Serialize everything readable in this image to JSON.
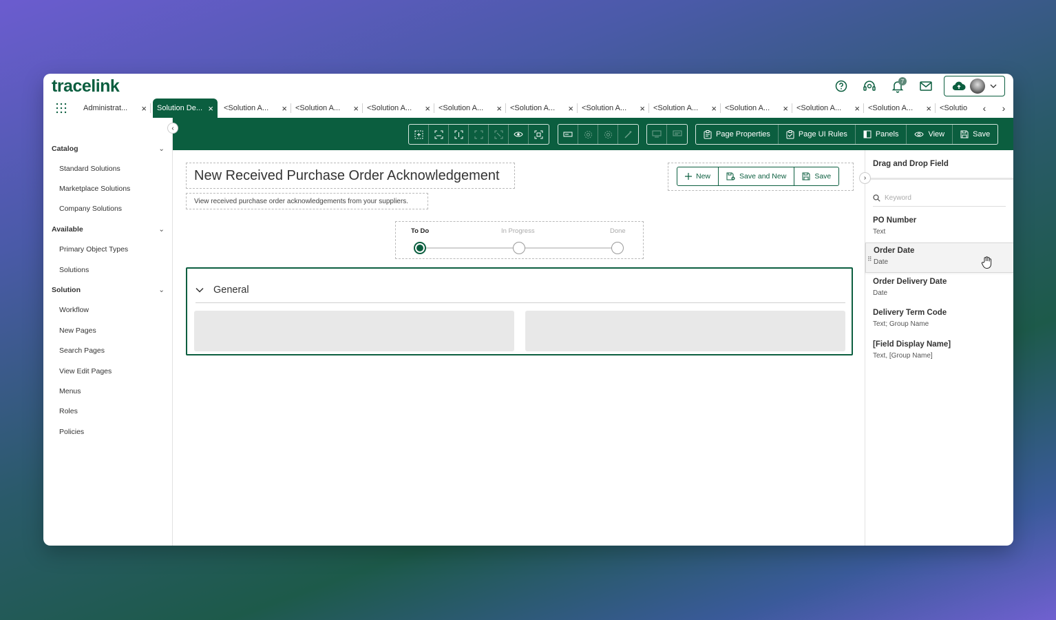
{
  "brand": {
    "logo_text": "tracelink",
    "accent": "#0b5e3f"
  },
  "header": {
    "notification_count": "7",
    "icons": [
      "help-icon",
      "support-icon",
      "bell-icon",
      "mail-icon",
      "cloud-upload-icon"
    ]
  },
  "tabs": {
    "items": [
      {
        "label": "Administrat...",
        "active": false
      },
      {
        "label": "Solution De...",
        "active": true
      },
      {
        "label": "<Solution A...",
        "active": false
      },
      {
        "label": "<Solution A...",
        "active": false
      },
      {
        "label": "<Solution A...",
        "active": false
      },
      {
        "label": "<Solution A...",
        "active": false
      },
      {
        "label": "<Solution A...",
        "active": false
      },
      {
        "label": "<Solution A...",
        "active": false
      },
      {
        "label": "<Solution A...",
        "active": false
      },
      {
        "label": "<Solution A...",
        "active": false
      },
      {
        "label": "<Solution A...",
        "active": false
      },
      {
        "label": "<Solution A...",
        "active": false
      },
      {
        "label": "<Solutio",
        "active": false
      }
    ]
  },
  "sidebar": {
    "sections": [
      {
        "label": "Catalog",
        "items": [
          "Standard Solutions",
          "Marketplace Solutions",
          "Company Solutions"
        ]
      },
      {
        "label": "Available",
        "items": [
          "Primary Object Types",
          "Solutions"
        ]
      },
      {
        "label": "Solution",
        "items": [
          "Workflow",
          "New Pages",
          "Search Pages",
          "View Edit Pages",
          "Menus",
          "Roles",
          "Policies"
        ]
      }
    ]
  },
  "toolbar": {
    "page_properties": "Page Properties",
    "page_ui_rules": "Page UI Rules",
    "panels": "Panels",
    "view": "View",
    "save": "Save"
  },
  "page": {
    "title": "New Received Purchase Order Acknowledgement",
    "subtitle": "View received purchase order acknowledgements from your suppliers.",
    "actions": {
      "new": "New",
      "save_and_new": "Save and New",
      "save": "Save"
    },
    "steps": [
      "To Do",
      "In Progress",
      "Done"
    ],
    "section_title": "General"
  },
  "right_panel": {
    "title": "Drag and Drop Field",
    "search_placeholder": "Keyword",
    "fields": [
      {
        "name": "PO Number",
        "type": "Text"
      },
      {
        "name": "Order Date",
        "type": "Date"
      },
      {
        "name": "Order Delivery Date",
        "type": "Date"
      },
      {
        "name": "Delivery Term Code",
        "type": "Text; Group Name"
      },
      {
        "name": "[Field Display Name]",
        "type": "Text, [Group Name]"
      }
    ]
  }
}
